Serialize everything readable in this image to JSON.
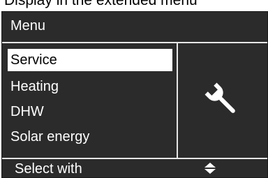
{
  "caption": "Display in the extended menu",
  "header": {
    "title": "Menu"
  },
  "menu": {
    "items": [
      {
        "label": "Service",
        "selected": true
      },
      {
        "label": "Heating",
        "selected": false
      },
      {
        "label": "DHW",
        "selected": false
      },
      {
        "label": "Solar energy",
        "selected": false
      }
    ],
    "side_icon": "wrench-icon"
  },
  "footer": {
    "text": "Select with",
    "icon": "up-down-arrows-icon"
  },
  "colors": {
    "screen_bg": "#2b2b2b",
    "text": "#ffffff",
    "highlight_bg": "#ffffff",
    "highlight_text": "#000000"
  }
}
